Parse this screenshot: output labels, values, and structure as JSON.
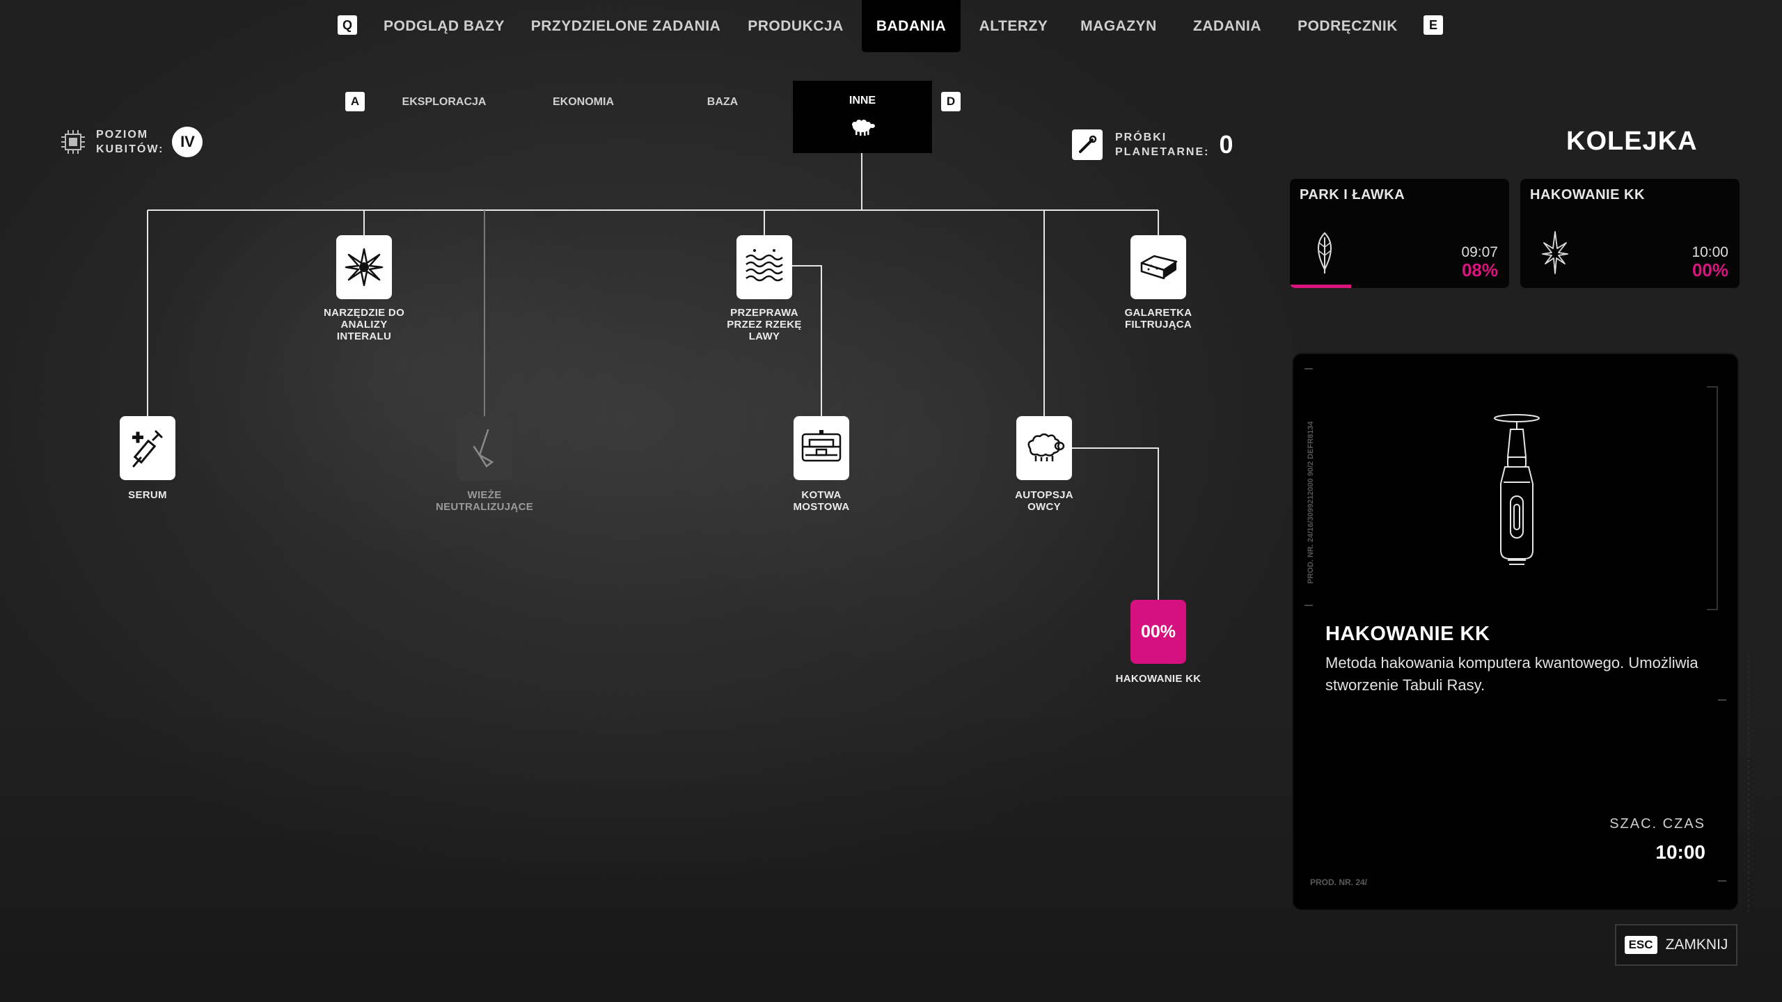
{
  "top_nav": {
    "key_left": "Q",
    "key_right": "E",
    "tabs": [
      {
        "label": "PODGLĄD BAZY"
      },
      {
        "label": "PRZYDZIELONE ZADANIA"
      },
      {
        "label": "PRODUKCJA"
      },
      {
        "label": "BADANIA",
        "active": true
      },
      {
        "label": "ALTERZY"
      },
      {
        "label": "MAGAZYN"
      },
      {
        "label": "ZADANIA"
      },
      {
        "label": "PODRĘCZNIK"
      }
    ]
  },
  "sub_nav": {
    "key_left": "A",
    "key_right": "D",
    "tabs": [
      {
        "label": "EKSPLORACJA"
      },
      {
        "label": "EKONOMIA"
      },
      {
        "label": "BAZA"
      },
      {
        "label": "INNE",
        "active": true,
        "icon": "sheep-icon"
      }
    ]
  },
  "poziom": {
    "label_line1": "POZIOM",
    "label_line2": "KUBITÓW:",
    "value": "IV",
    "icon": "chip-icon"
  },
  "probki": {
    "label_line1": "PRÓBKI",
    "label_line2": "PLANETARNE:",
    "value": "0",
    "icon": "sample-tool-icon"
  },
  "tree": {
    "nodes": [
      {
        "id": "narzedzie",
        "label_lines": [
          "NARZĘDZIE DO",
          "ANALIZY",
          "INTERALU"
        ],
        "icon": "star-burst-icon",
        "state": "available"
      },
      {
        "id": "przeprawa",
        "label_lines": [
          "PRZEPRAWA",
          "PRZEZ RZEKĘ",
          "LAWY"
        ],
        "icon": "lava-waves-icon",
        "state": "available"
      },
      {
        "id": "galaretka",
        "label_lines": [
          "GALARETKA",
          "FILTRUJĄCA"
        ],
        "icon": "jelly-block-icon",
        "state": "available"
      },
      {
        "id": "serum",
        "label_lines": [
          "SERUM"
        ],
        "icon": "syringe-icon",
        "state": "available"
      },
      {
        "id": "wieze",
        "label_lines": [
          "WIEŻE",
          "NEUTRALIZUJĄCE"
        ],
        "icon": "tower-icon",
        "state": "locked"
      },
      {
        "id": "kotwa",
        "label_lines": [
          "KOTWA",
          "MOSTOWA"
        ],
        "icon": "bridge-anchor-icon",
        "state": "available"
      },
      {
        "id": "autopsja",
        "label_lines": [
          "AUTOPSJA",
          "OWCY"
        ],
        "icon": "sheep-icon",
        "state": "available"
      },
      {
        "id": "hakowanie",
        "label_lines": [
          "HAKOWANIE KK"
        ],
        "icon": "",
        "state": "in-progress",
        "progress_text": "00%"
      }
    ]
  },
  "queue": {
    "title": "KOLEJKA",
    "items": [
      {
        "title": "PARK I ŁAWKA",
        "time": "09:07",
        "percent": "08%",
        "progress": 0.08,
        "icon": "leaf-icon"
      },
      {
        "title": "HAKOWANIE KK",
        "time": "10:00",
        "percent": "00%",
        "progress": 0.0,
        "icon": "star-needle-icon"
      }
    ]
  },
  "detail": {
    "title": "HAKOWANIE KK",
    "description": "Metoda hakowania komputera kwantowego. Umożliwia stworzenie Tabuli Rasy.",
    "est_label": "SZAC. CZAS",
    "est_value": "10:00",
    "side_text": "PROD. NR. 24/16/3099212000 90/2  DEFR8134",
    "footer_text": "PROD. NR. 24/",
    "item_icon": "quantum-hack-device-icon"
  },
  "close": {
    "key": "ESC",
    "label": "ZAMKNIJ"
  },
  "colors": {
    "accent": "#d4117f",
    "panel": "#000000",
    "node": "#ffffff"
  }
}
